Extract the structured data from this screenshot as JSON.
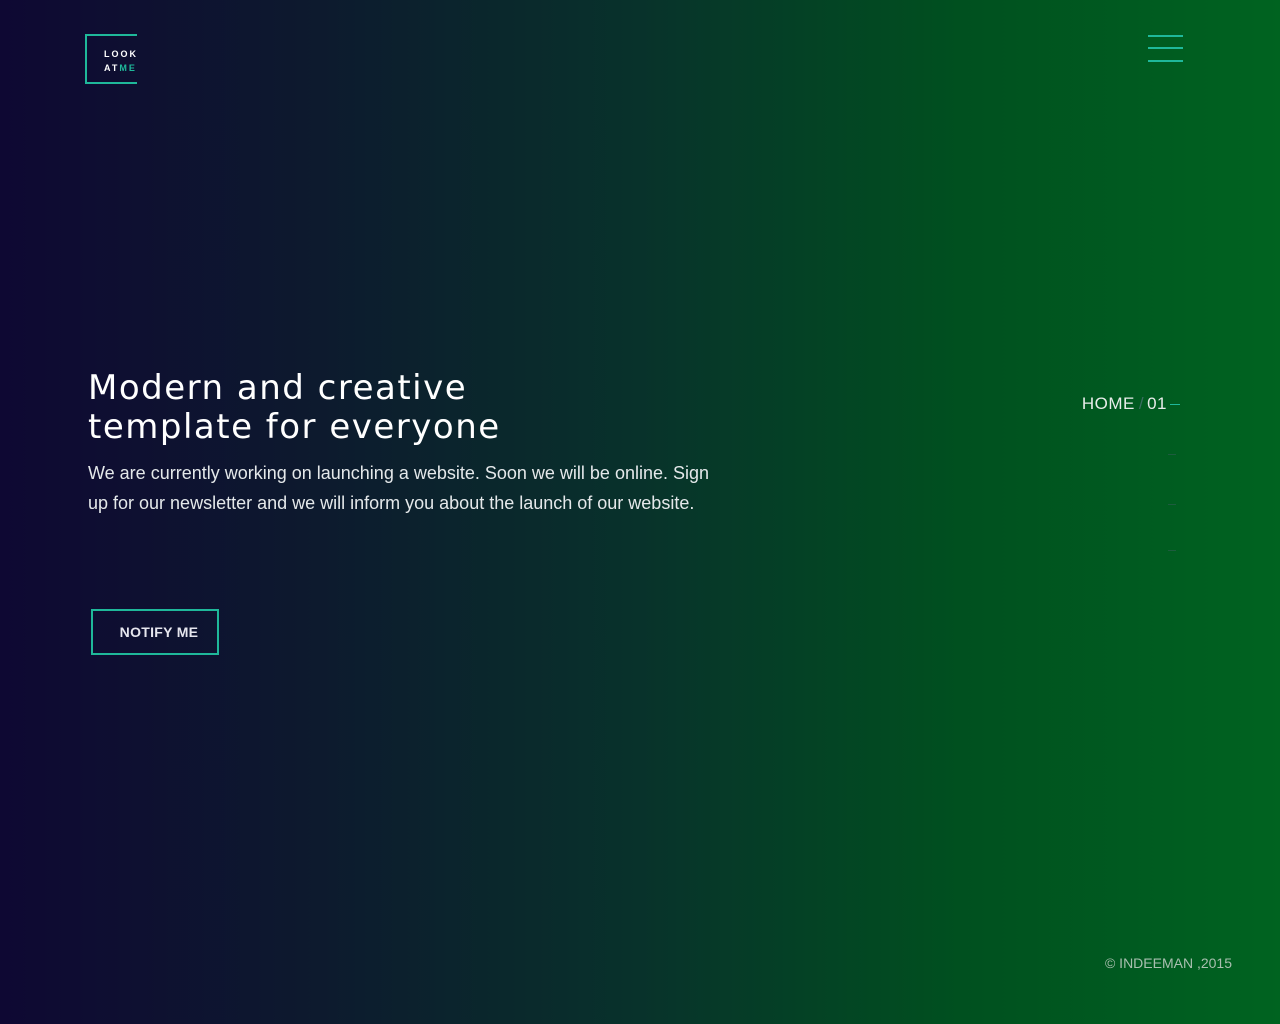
{
  "header": {
    "logo": {
      "line1": "LOOK",
      "line2_part1": "AT",
      "line2_part2": "ME"
    },
    "menu_icon": "hamburger-menu-icon"
  },
  "hero": {
    "title_line1": "Modern and creative",
    "title_line2": "template for everyone",
    "description": "We are currently working on launching a website. Soon we will be online. Sign up for our newsletter and we will inform you about the launch of our website.",
    "button_label": "NOTIFY ME"
  },
  "section_nav": {
    "current_label": "HOME",
    "separator": "/",
    "current_number": "01"
  },
  "footer": {
    "copyright": "© INDEEMAN ,2015"
  },
  "colors": {
    "accent": "#1fb89a",
    "gradient_start": "#0e0833",
    "gradient_end": "#006320"
  }
}
